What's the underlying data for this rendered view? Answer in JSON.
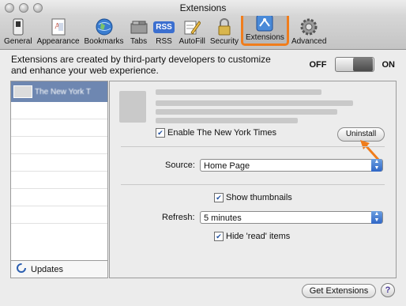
{
  "window": {
    "title": "Extensions"
  },
  "toolbar": {
    "items": [
      {
        "label": "General"
      },
      {
        "label": "Appearance"
      },
      {
        "label": "Bookmarks"
      },
      {
        "label": "Tabs"
      },
      {
        "label": "RSS"
      },
      {
        "label": "AutoFill"
      },
      {
        "label": "Security"
      },
      {
        "label": "Extensions"
      },
      {
        "label": "Advanced"
      }
    ],
    "rss_icon_text": "RSS"
  },
  "intro": {
    "text": "Extensions are created by third-party developers to customize and enhance your web experience.",
    "off": "OFF",
    "on": "ON"
  },
  "sidebar": {
    "selected_item": "The New York T",
    "updates": "Updates"
  },
  "extension": {
    "enable_label": "Enable The New York Times",
    "uninstall": "Uninstall",
    "source_label": "Source:",
    "source_value": "Home Page",
    "show_thumbnails": "Show thumbnails",
    "refresh_label": "Refresh:",
    "refresh_value": "5 minutes",
    "hide_read": "Hide 'read' items"
  },
  "footer": {
    "get_extensions": "Get Extensions",
    "help": "?"
  },
  "colors": {
    "highlight": "#f07d1c",
    "selection": "#6e87b1",
    "select_arrow": "#2f66c6"
  }
}
